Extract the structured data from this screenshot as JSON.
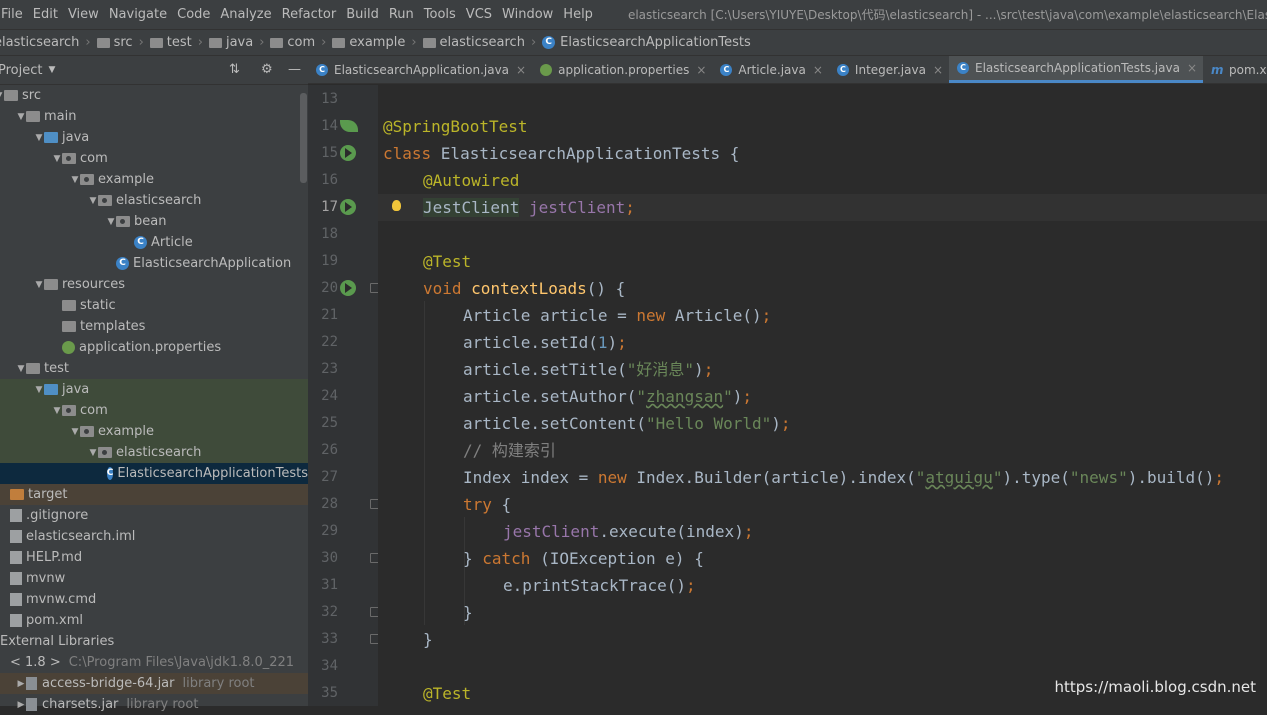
{
  "menu": [
    "File",
    "Edit",
    "View",
    "Navigate",
    "Code",
    "Analyze",
    "Refactor",
    "Build",
    "Run",
    "Tools",
    "VCS",
    "Window",
    "Help"
  ],
  "window_title": "elasticsearch [C:\\Users\\YIUYE\\Desktop\\代码\\elasticsearch] - ...\\src\\test\\java\\com\\example\\elasticsearch\\ElasticsearchApplicationTests.java",
  "breadcrumbs": [
    "elasticsearch",
    "src",
    "test",
    "java",
    "com",
    "example",
    "elasticsearch",
    "ElasticsearchApplicationTests"
  ],
  "project_panel": {
    "title": "Project",
    "icons": [
      "collapse-icon",
      "gear-icon",
      "minimize-icon"
    ],
    "tree": [
      {
        "label": "src",
        "depth": 0,
        "icon": "folder",
        "expanded": true
      },
      {
        "label": "main",
        "depth": 1,
        "icon": "folder",
        "expanded": true
      },
      {
        "label": "java",
        "depth": 2,
        "icon": "folder-blue",
        "expanded": true
      },
      {
        "label": "com",
        "depth": 3,
        "icon": "package",
        "expanded": true
      },
      {
        "label": "example",
        "depth": 4,
        "icon": "package",
        "expanded": true
      },
      {
        "label": "elasticsearch",
        "depth": 5,
        "icon": "package",
        "expanded": true
      },
      {
        "label": "bean",
        "depth": 6,
        "icon": "package",
        "expanded": true
      },
      {
        "label": "Article",
        "depth": 7,
        "icon": "class"
      },
      {
        "label": "ElasticsearchApplication",
        "depth": 6,
        "icon": "class"
      },
      {
        "label": "resources",
        "depth": 2,
        "icon": "folder",
        "expanded": true
      },
      {
        "label": "static",
        "depth": 3,
        "icon": "folder"
      },
      {
        "label": "templates",
        "depth": 3,
        "icon": "folder"
      },
      {
        "label": "application.properties",
        "depth": 3,
        "icon": "leaf"
      },
      {
        "label": "test",
        "depth": 1,
        "icon": "folder",
        "expanded": true
      },
      {
        "label": "java",
        "depth": 2,
        "icon": "folder-blue",
        "expanded": true,
        "highlight": "green"
      },
      {
        "label": "com",
        "depth": 3,
        "icon": "package",
        "expanded": true,
        "highlight": "green"
      },
      {
        "label": "example",
        "depth": 4,
        "icon": "package",
        "expanded": true,
        "highlight": "green"
      },
      {
        "label": "elasticsearch",
        "depth": 5,
        "icon": "package",
        "expanded": true,
        "highlight": "green"
      },
      {
        "label": "ElasticsearchApplicationTests",
        "depth": 6,
        "icon": "class",
        "highlight": "selected"
      },
      {
        "label": "target",
        "depth": 0,
        "icon": "folder-orange",
        "highlight": "olive"
      },
      {
        "label": ".gitignore",
        "depth": 0,
        "icon": "file"
      },
      {
        "label": "elasticsearch.iml",
        "depth": 0,
        "icon": "file"
      },
      {
        "label": "HELP.md",
        "depth": 0,
        "icon": "file"
      },
      {
        "label": "mvnw",
        "depth": 0,
        "icon": "file"
      },
      {
        "label": "mvnw.cmd",
        "depth": 0,
        "icon": "file"
      },
      {
        "label": "pom.xml",
        "depth": 0,
        "icon": "file"
      },
      {
        "label": "External Libraries",
        "depth": -1,
        "icon": "none"
      },
      {
        "label": "< 1.8 >",
        "depth": 0,
        "icon": "none",
        "muted": "C:\\Program Files\\Java\\jdk1.8.0_221"
      },
      {
        "label": "access-bridge-64.jar",
        "depth": 1,
        "icon": "jar",
        "muted": "library root",
        "highlight": "olive"
      },
      {
        "label": "charsets.jar",
        "depth": 1,
        "icon": "jar",
        "muted": "library root"
      }
    ]
  },
  "tabs": [
    {
      "label": "ElasticsearchApplication.java",
      "icon": "class",
      "active": false
    },
    {
      "label": "application.properties",
      "icon": "leaf",
      "active": false
    },
    {
      "label": "Article.java",
      "icon": "class",
      "active": false
    },
    {
      "label": "Integer.java",
      "icon": "class",
      "active": false
    },
    {
      "label": "ElasticsearchApplicationTests.java",
      "icon": "class",
      "active": true
    },
    {
      "label": "pom.xml",
      "icon": "maven",
      "active": false
    }
  ],
  "line_numbers": [
    "13",
    "14",
    "15",
    "16",
    "17",
    "18",
    "19",
    "20",
    "21",
    "22",
    "23",
    "24",
    "25",
    "26",
    "27",
    "28",
    "29",
    "30",
    "31",
    "32",
    "33",
    "34",
    "35"
  ],
  "current_line": "17",
  "code_lines": [
    [],
    [
      [
        "ann",
        "@SpringBootTest"
      ]
    ],
    [
      [
        "kw",
        "class "
      ],
      [
        "",
        "ElasticsearchApplicationTests {"
      ]
    ],
    [
      [
        "ind1",
        ""
      ],
      [
        "ann",
        "@Autowired"
      ]
    ],
    [
      [
        "ind1",
        ""
      ],
      [
        "hl",
        "JestClient"
      ],
      [
        "",
        " "
      ],
      [
        "fld",
        "jestClient"
      ],
      [
        "kw",
        ";"
      ]
    ],
    [],
    [
      [
        "ind1",
        ""
      ],
      [
        "ann",
        "@Test"
      ]
    ],
    [
      [
        "ind1",
        ""
      ],
      [
        "kw",
        "void "
      ],
      [
        "mth",
        "contextLoads"
      ],
      [
        "",
        "() {"
      ]
    ],
    [
      [
        "ind2",
        ""
      ],
      [
        "",
        "Article article = "
      ],
      [
        "kw",
        "new "
      ],
      [
        "",
        "Article()"
      ],
      [
        "kw",
        ";"
      ]
    ],
    [
      [
        "ind2",
        ""
      ],
      [
        "",
        "article.setId("
      ],
      [
        "num",
        "1"
      ],
      [
        "",
        ")"
      ],
      [
        "kw",
        ";"
      ]
    ],
    [
      [
        "ind2",
        ""
      ],
      [
        "",
        "article.setTitle("
      ],
      [
        "str",
        "\"好消息\""
      ],
      [
        "",
        ")"
      ],
      [
        "kw",
        ";"
      ]
    ],
    [
      [
        "ind2",
        ""
      ],
      [
        "",
        "article.setAuthor("
      ],
      [
        "str",
        "\""
      ],
      [
        "strw",
        "zhangsan"
      ],
      [
        "str",
        "\""
      ],
      [
        "",
        ")"
      ],
      [
        "kw",
        ";"
      ]
    ],
    [
      [
        "ind2",
        ""
      ],
      [
        "",
        "article.setContent("
      ],
      [
        "str",
        "\"Hello World\""
      ],
      [
        "",
        ")"
      ],
      [
        "kw",
        ";"
      ]
    ],
    [
      [
        "ind2",
        ""
      ],
      [
        "cmt",
        "// 构建索引"
      ]
    ],
    [
      [
        "ind2",
        ""
      ],
      [
        "",
        "Index index = "
      ],
      [
        "kw",
        "new "
      ],
      [
        "",
        "Index.Builder(article).index("
      ],
      [
        "str",
        "\""
      ],
      [
        "strw",
        "atguigu"
      ],
      [
        "str",
        "\""
      ],
      [
        "",
        ").type("
      ],
      [
        "str",
        "\"news\""
      ],
      [
        "",
        ").build()"
      ],
      [
        "kw",
        ";"
      ]
    ],
    [
      [
        "ind2",
        ""
      ],
      [
        "kw",
        "try "
      ],
      [
        "",
        "{"
      ]
    ],
    [
      [
        "ind3",
        ""
      ],
      [
        "fld",
        "jestClient"
      ],
      [
        "",
        ".execute(index)"
      ],
      [
        "kw",
        ";"
      ]
    ],
    [
      [
        "ind2",
        ""
      ],
      [
        "",
        "} "
      ],
      [
        "kw",
        "catch "
      ],
      [
        "",
        "(IOException e) {"
      ]
    ],
    [
      [
        "ind3",
        ""
      ],
      [
        "",
        "e.printStackTrace()"
      ],
      [
        "kw",
        ";"
      ]
    ],
    [
      [
        "ind2",
        ""
      ],
      [
        "",
        "}"
      ]
    ],
    [
      [
        "ind1",
        ""
      ],
      [
        "",
        "}"
      ]
    ],
    [],
    [
      [
        "ind1",
        ""
      ],
      [
        "ann",
        "@Test"
      ]
    ]
  ],
  "gutter_marks": {
    "14": "leaf",
    "15": "run",
    "17": "run",
    "20": "run"
  },
  "fold_marks": [
    "20",
    "28",
    "30",
    "32",
    "33"
  ],
  "watermark": "https://maoli.blog.csdn.net"
}
